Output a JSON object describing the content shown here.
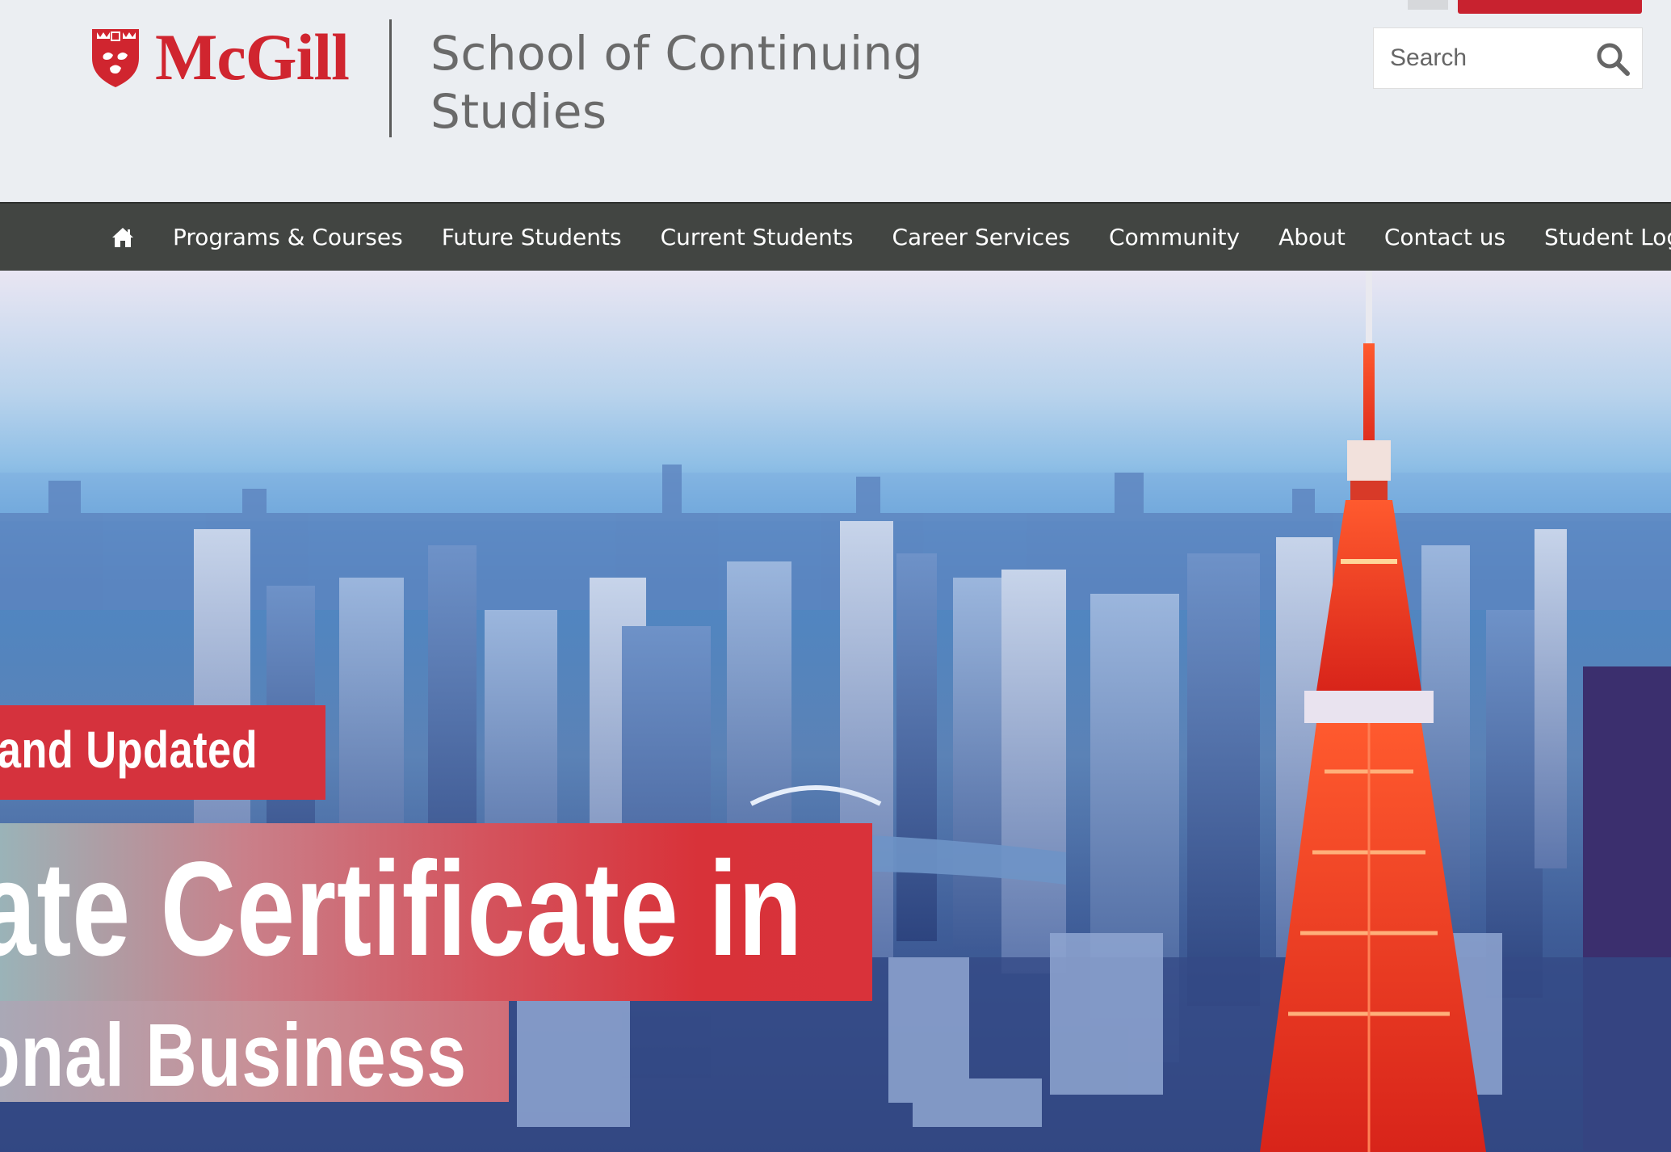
{
  "brand": {
    "wordmark": "McGill",
    "school_name": "School of Continuing Studies",
    "red": "#d0252f"
  },
  "search": {
    "placeholder": "Search",
    "icon": "search-icon"
  },
  "nav": {
    "home_icon": "home-icon",
    "items": [
      {
        "label": "Programs & Courses"
      },
      {
        "label": "Future Students"
      },
      {
        "label": "Current Students"
      },
      {
        "label": "Career Services"
      },
      {
        "label": "Community"
      },
      {
        "label": "About"
      },
      {
        "label": "Contact us"
      },
      {
        "label": "Student Login"
      }
    ]
  },
  "hero": {
    "tag": "ed and Updated",
    "headline_line1": "uate Certificate in",
    "headline_line2": "tional Business",
    "tag_color": "#d5323d"
  }
}
